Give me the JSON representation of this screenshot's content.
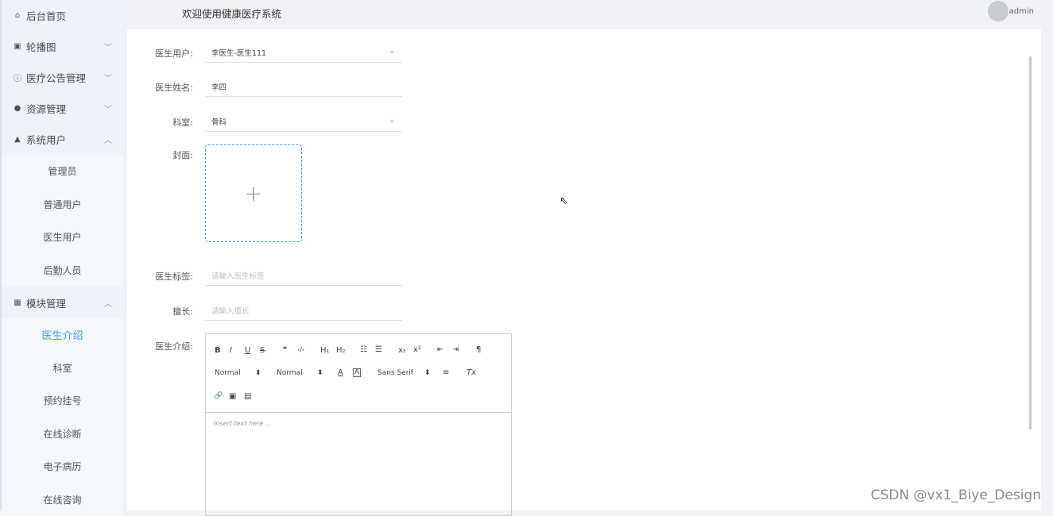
{
  "header": {
    "title": "欢迎使用健康医疗系统",
    "user": "admin"
  },
  "sidebar": {
    "menus": [
      {
        "label": "后台首页",
        "icon": "home-icon",
        "glyph": "⌂",
        "arrow": ""
      },
      {
        "label": "轮播图",
        "icon": "image-icon",
        "glyph": "▣",
        "arrow": "﹀"
      },
      {
        "label": "医疗公告管理",
        "icon": "info-icon",
        "glyph": "ⓘ",
        "arrow": "﹀"
      },
      {
        "label": "资源管理",
        "icon": "location-icon",
        "glyph": "●",
        "arrow": "﹀"
      },
      {
        "label": "系统用户",
        "icon": "user-icon",
        "glyph": "▲",
        "arrow": "︿"
      }
    ],
    "system_sub": [
      "管理员",
      "普通用户",
      "医生用户",
      "后勤人员"
    ],
    "module_menu": {
      "label": "模块管理",
      "icon": "grid-icon",
      "glyph": "▦",
      "arrow": "︿"
    },
    "module_sub": [
      "医生介绍",
      "科室",
      "预约挂号",
      "在线诊断",
      "电子病历",
      "在线咨询"
    ],
    "active": "医生介绍"
  },
  "form": {
    "doctor_user": {
      "label": "医生用户:",
      "value": "李医生-医生111"
    },
    "doctor_name": {
      "label": "医生姓名:",
      "value": "李四"
    },
    "department": {
      "label": "科室:",
      "value": "骨科"
    },
    "cover": {
      "label": "封面:",
      "glyph": "+"
    },
    "tags": {
      "label": "医生标签:",
      "placeholder": "请输入医生标签"
    },
    "specialty": {
      "label": "擅长:",
      "placeholder": "请输入擅长"
    },
    "intro": {
      "label": "医生介绍:"
    }
  },
  "editor": {
    "row1": [
      "B",
      "I",
      "U",
      "S",
      "❞",
      "‹/›",
      "H₁",
      "H₂",
      "☷",
      "☰",
      "x₂",
      "x²",
      "⇤",
      "⇥",
      "¶"
    ],
    "header_select": "Normal",
    "size_select": "Normal",
    "font_color": "A",
    "bg_color": "A",
    "font_select": "Sans Serif",
    "align": "≡",
    "clear": "Tx",
    "link": "🔗",
    "image": "▣",
    "video": "▤",
    "placeholder": "Insert text here ..."
  },
  "watermark": "CSDN @vx1_Biye_Design",
  "colors": {
    "accent": "#409eff",
    "sidebar_bg": "#eef3fa"
  }
}
